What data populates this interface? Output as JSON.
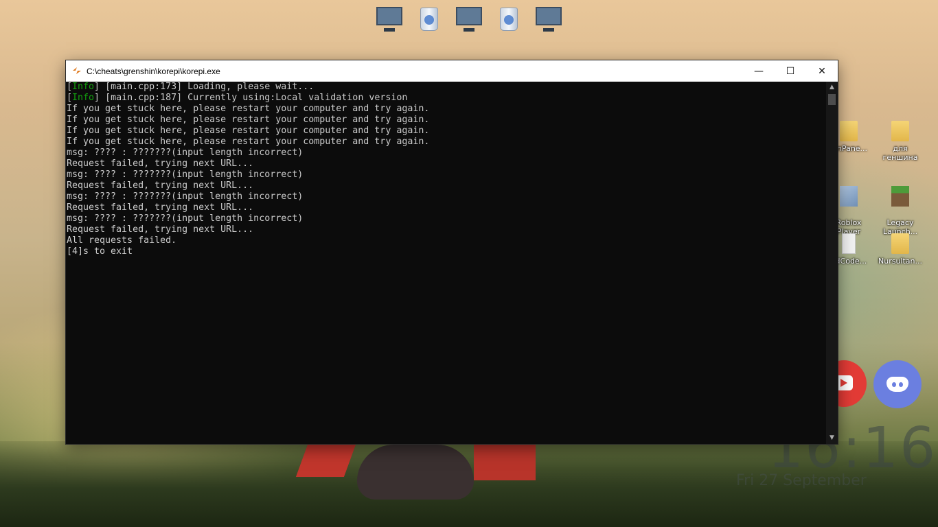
{
  "window": {
    "title": "C:\\cheats\\grenshin\\korepi\\korepi.exe",
    "minimize_glyph": "—",
    "maximize_glyph": "☐",
    "close_glyph": "✕"
  },
  "console": {
    "lines": [
      {
        "tag": "Info",
        "text": " [main.cpp:173] Loading, please wait..."
      },
      {
        "tag": "Info",
        "text": " [main.cpp:187] Currently using:Local validation version"
      },
      {
        "tag": "",
        "text": "If you get stuck here, please restart your computer and try again."
      },
      {
        "tag": "",
        "text": "If you get stuck here, please restart your computer and try again."
      },
      {
        "tag": "",
        "text": "If you get stuck here, please restart your computer and try again."
      },
      {
        "tag": "",
        "text": "If you get stuck here, please restart your computer and try again."
      },
      {
        "tag": "",
        "text": "msg: ???? : ???????(input length incorrect)"
      },
      {
        "tag": "",
        "text": "Request failed, trying next URL..."
      },
      {
        "tag": "",
        "text": "msg: ???? : ???????(input length incorrect)"
      },
      {
        "tag": "",
        "text": "Request failed, trying next URL..."
      },
      {
        "tag": "",
        "text": "msg: ???? : ???????(input length incorrect)"
      },
      {
        "tag": "",
        "text": "Request failed, trying next URL..."
      },
      {
        "tag": "",
        "text": "msg: ???? : ???????(input length incorrect)"
      },
      {
        "tag": "",
        "text": "Request failed, trying next URL..."
      },
      {
        "tag": "",
        "text": "All requests failed."
      },
      {
        "tag": "",
        "text": "[4]s to exit"
      }
    ]
  },
  "desktop": {
    "right_icons": [
      {
        "label": "ninPane...",
        "icon": "folder-icon"
      },
      {
        "label": "для геншина",
        "icon": "folder-icon"
      },
      {
        "label": "Roblox\nPlayer",
        "icon": "roblox-icon"
      },
      {
        "label": "Legacy\nLaunch...",
        "icon": "minecraft-icon"
      },
      {
        "label": "adCode...",
        "icon": "file-icon"
      },
      {
        "label": "Nursultan...",
        "icon": "folder-icon"
      }
    ],
    "clock_time": "16:16",
    "clock_date": "Fri 27 September"
  },
  "colors": {
    "console_bg": "#0c0c0c",
    "console_text": "#cccccc",
    "info_tag": "#13a10e",
    "titlebar": "#ffffff"
  }
}
